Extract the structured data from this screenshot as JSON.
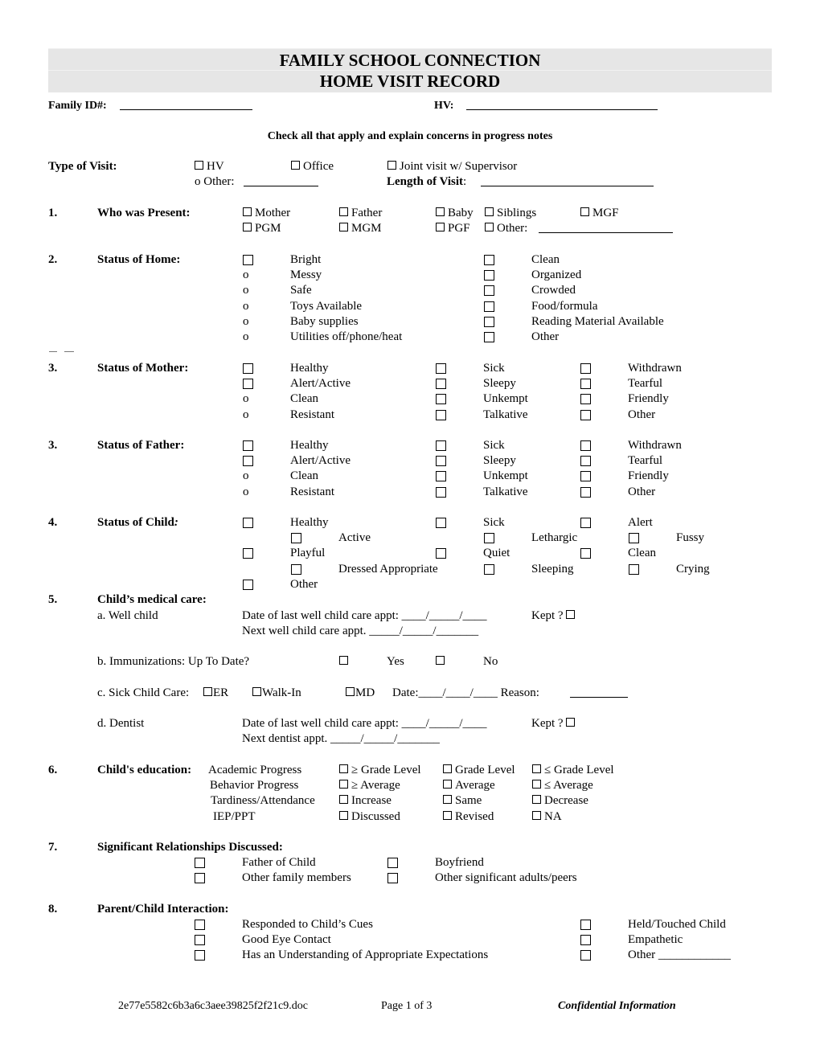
{
  "header": {
    "title_line1": "FAMILY SCHOOL CONNECTION",
    "title_line2": "HOME VISIT RECORD"
  },
  "fields": {
    "family_id_label": "Family ID#:",
    "family_id_value": "",
    "hv_label": "HV:",
    "hv_value": ""
  },
  "instructions": "Check all that apply and explain concerns in progress notes",
  "type_of_visit": {
    "label": "Type of Visit:",
    "options": [
      "HV",
      "Office",
      "Joint visit w/ Supervisor"
    ],
    "other_label": "o Other:",
    "length_label": "Length of Visit",
    "length_colon": ":"
  },
  "sections": {
    "s1": {
      "number": "1.",
      "label": "Who was Present:",
      "row1": [
        "Mother",
        "Father",
        "Baby",
        "Siblings",
        "MGF"
      ],
      "row2": [
        "PGM",
        "MGM",
        "PGF",
        "Other:"
      ]
    },
    "s2": {
      "number": "2.",
      "label": "Status of Home:",
      "left_marks": [
        "box",
        "o",
        "o",
        "o",
        "o",
        "o"
      ],
      "left": [
        "Bright",
        "Messy",
        "Safe",
        "Toys Available",
        "Baby supplies",
        "Utilities off/phone/heat"
      ],
      "right": [
        "Clean",
        "Organized",
        "Crowded",
        "Food/formula",
        "Reading Material Available",
        "Other"
      ]
    },
    "s3m": {
      "number": "3.",
      "label": "Status of Mother:",
      "col1_marks": [
        "box",
        "box",
        "o",
        "o"
      ],
      "col1": [
        "Healthy",
        "Alert/Active",
        "Clean",
        "Resistant"
      ],
      "col2": [
        "Sick",
        "Sleepy",
        "Unkempt",
        "Talkative"
      ],
      "col3": [
        "Withdrawn",
        "Tearful",
        "Friendly",
        "Other"
      ]
    },
    "s3f": {
      "number": "3.",
      "label": "Status of Father:",
      "col1_marks": [
        "box",
        "box",
        "o",
        "o"
      ],
      "col1": [
        "Healthy",
        "Alert/Active",
        "Clean",
        "Resistant"
      ],
      "col2": [
        "Sick",
        "Sleepy",
        "Unkempt",
        "Talkative"
      ],
      "col3": [
        "Withdrawn",
        "Tearful",
        "Friendly",
        "Other"
      ]
    },
    "s4": {
      "number": "4.",
      "label": "Status of Child",
      "label_colon": ":",
      "row1": [
        "Healthy",
        "Sick",
        "Alert"
      ],
      "row2": [
        "Active",
        "Lethargic",
        "Fussy"
      ],
      "row3": [
        "Playful",
        "Quiet",
        "Clean"
      ],
      "row4": [
        "Dressed Appropriate",
        "Sleeping",
        "Crying"
      ],
      "row5": [
        "Other"
      ]
    },
    "s5": {
      "number": "5.",
      "label": "Child’s medical care:",
      "a_label": "a. Well child",
      "a_last": "Date of last well child care appt: ____/_____/____",
      "a_kept": "Kept ?",
      "a_next": "Next well child care appt.  _____/_____/_______",
      "b_label": "b.  Immunizations:  Up To Date?",
      "b_yes": "Yes",
      "b_no": "No",
      "c_label": "c. Sick Child Care:",
      "c_er": "ER",
      "c_walkin": "Walk-In",
      "c_md": "MD",
      "c_date": "Date:____/____/____ Reason:",
      "d_label": "d. Dentist",
      "d_last": "Date of last well child care appt: ____/_____/____",
      "d_kept": "Kept ?",
      "d_next": "Next dentist appt.  _____/_____/_______"
    },
    "s6": {
      "number": "6.",
      "label": "Child's education:",
      "rows": [
        {
          "name": "Academic Progress",
          "options": [
            "≥ Grade Level",
            "Grade Level",
            "≤ Grade Level"
          ]
        },
        {
          "name": "Behavior Progress",
          "options": [
            "≥ Average",
            "Average",
            "≤ Average"
          ]
        },
        {
          "name": "Tardiness/Attendance",
          "options": [
            "Increase",
            "Same",
            "Decrease"
          ]
        },
        {
          "name": "IEP/PPT",
          "options": [
            "Discussed",
            "Revised",
            "NA"
          ]
        }
      ]
    },
    "s7": {
      "number": "7.",
      "label": "Significant Relationships Discussed:",
      "left": [
        "Father of Child",
        "Other family members"
      ],
      "right": [
        "Boyfriend",
        "Other significant adults/peers"
      ]
    },
    "s8": {
      "number": "8.",
      "label": "Parent/Child Interaction:",
      "left": [
        "Responded to Child’s Cues",
        "Good Eye Contact",
        "Has an Understanding of Appropriate Expectations"
      ],
      "right": [
        "Held/Touched Child",
        "Empathetic",
        "Other ____________"
      ]
    }
  },
  "footer": {
    "filename": "2e77e5582c6b3a6c3aee39825f2f21c9.doc",
    "page": "Page 1 of 3",
    "confidential": "Confidential Information"
  }
}
